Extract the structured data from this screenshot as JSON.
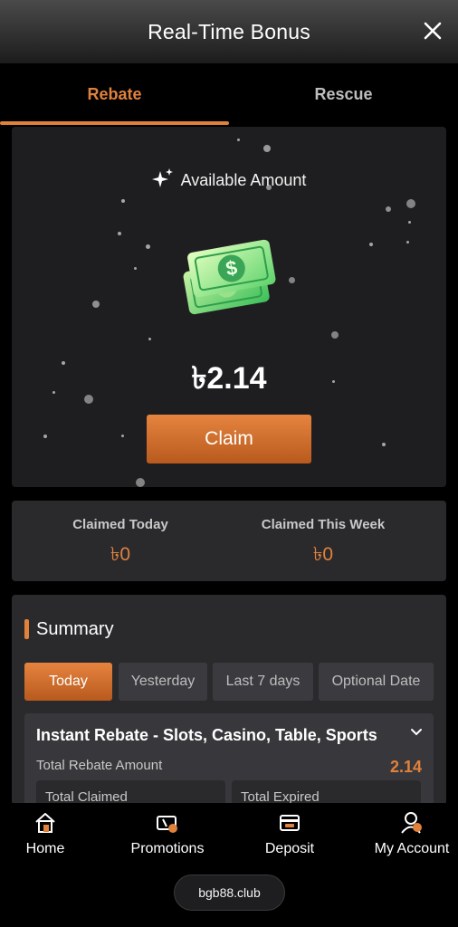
{
  "header": {
    "title": "Real-Time Bonus",
    "close_icon": "close-icon"
  },
  "tabs": [
    {
      "label": "Rebate",
      "active": true
    },
    {
      "label": "Rescue",
      "active": false
    }
  ],
  "available": {
    "label": "Available Amount",
    "amount": "৳2.14",
    "claim_label": "Claim",
    "sparkle_icon": "sparkle-icon",
    "money_icon": "money-bills-icon"
  },
  "claimed": {
    "today_label": "Claimed Today",
    "today_value": "৳0",
    "week_label": "Claimed This Week",
    "week_value": "৳0"
  },
  "summary": {
    "title": "Summary",
    "filters": [
      "Today",
      "Yesterday",
      "Last 7 days",
      "Optional Date"
    ],
    "active_filter": "Today",
    "rebate": {
      "title": "Instant Rebate - Slots, Casino, Table, Sports",
      "total_label": "Total Rebate Amount",
      "total_value": "2.14",
      "claimed_label": "Total Claimed",
      "expired_label": "Total Expired"
    }
  },
  "bottom_nav": {
    "items": [
      {
        "label": "Home",
        "icon": "home-icon"
      },
      {
        "label": "Promotions",
        "icon": "promotions-icon"
      },
      {
        "label": "Deposit",
        "icon": "deposit-icon"
      },
      {
        "label": "My Account",
        "icon": "account-icon"
      }
    ],
    "domain": "bgb88.club"
  },
  "colors": {
    "accent": "#e0813c",
    "card": "#2a2a2d",
    "background": "#000000"
  }
}
